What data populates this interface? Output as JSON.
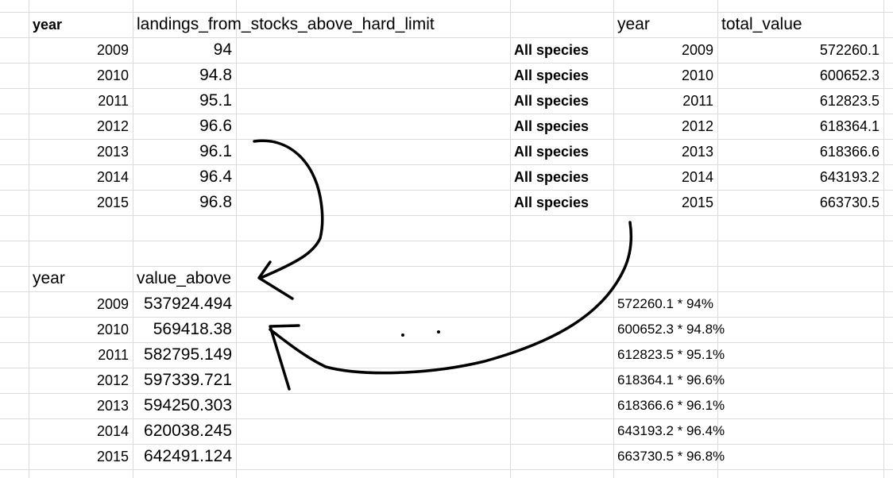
{
  "landings_table": {
    "header_year": "year",
    "header_value": "landings_from_stocks_above_hard_limit",
    "rows": [
      {
        "year": "2009",
        "value": "94"
      },
      {
        "year": "2010",
        "value": "94.8"
      },
      {
        "year": "2011",
        "value": "95.1"
      },
      {
        "year": "2012",
        "value": "96.6"
      },
      {
        "year": "2013",
        "value": "96.1"
      },
      {
        "year": "2014",
        "value": "96.4"
      },
      {
        "year": "2015",
        "value": "96.8"
      }
    ]
  },
  "total_value_table": {
    "header_year": "year",
    "header_value": "total_value",
    "rows": [
      {
        "species": "All species",
        "year": "2009",
        "value": "572260.1"
      },
      {
        "species": "All species",
        "year": "2010",
        "value": "600652.3"
      },
      {
        "species": "All species",
        "year": "2011",
        "value": "612823.5"
      },
      {
        "species": "All species",
        "year": "2012",
        "value": "618364.1"
      },
      {
        "species": "All species",
        "year": "2013",
        "value": "618366.6"
      },
      {
        "species": "All species",
        "year": "2014",
        "value": "643193.2"
      },
      {
        "species": "All species",
        "year": "2015",
        "value": "663730.5"
      }
    ]
  },
  "value_above_table": {
    "header_year": "year",
    "header_value": "value_above",
    "rows": [
      {
        "year": "2009",
        "value": "537924.494",
        "formula": "572260.1 * 94%"
      },
      {
        "year": "2010",
        "value": "569418.38",
        "formula": "600652.3 * 94.8%"
      },
      {
        "year": "2011",
        "value": "582795.149",
        "formula": "612823.5 * 95.1%"
      },
      {
        "year": "2012",
        "value": "597339.721",
        "formula": "618364.1 * 96.6%"
      },
      {
        "year": "2013",
        "value": "594250.303",
        "formula": "618366.6 * 96.1%"
      },
      {
        "year": "2014",
        "value": "620038.245",
        "formula": "643193.2 * 96.4%"
      },
      {
        "year": "2015",
        "value": "642491.124",
        "formula": "663730.5 * 96.8%"
      }
    ]
  },
  "colors": {
    "gridline": "#dcdcdc",
    "text": "#000000",
    "annotation_ink": "#000000"
  }
}
